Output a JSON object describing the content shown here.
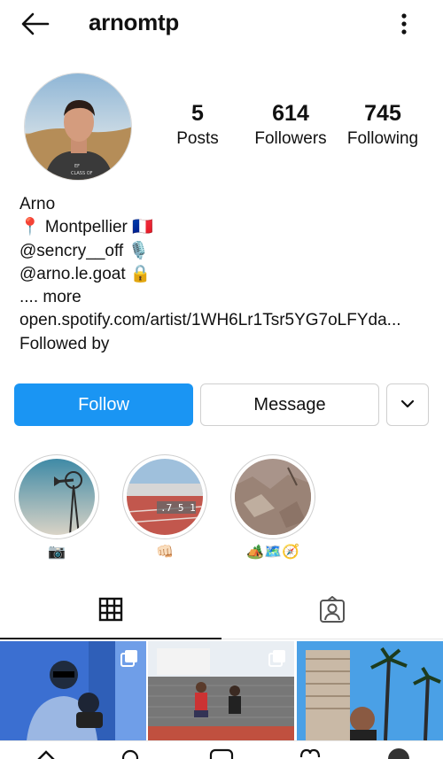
{
  "header": {
    "username": "arnomtp",
    "back_icon": "arrow-left-icon",
    "menu_icon": "kebab-icon"
  },
  "profile": {
    "avatar_icon": "profile-photo",
    "stats": {
      "posts_count": "5",
      "posts_label": "Posts",
      "followers_count": "614",
      "followers_label": "Followers",
      "following_count": "745",
      "following_label": "Following"
    },
    "bio": {
      "name": "Arno",
      "location": "📍 Montpellier 🇫🇷",
      "mention1": "@sencry__off 🎙️",
      "mention2": "@arno.le.goat 🔒",
      "more": ".... more",
      "link": "open.spotify.com/artist/1WH6Lr1Tsr5YG7oLFYda...",
      "followed_by": "Followed by"
    }
  },
  "actions": {
    "follow_label": "Follow",
    "message_label": "Message",
    "more_icon": "chevron-down-icon"
  },
  "highlights": [
    {
      "label": "📷"
    },
    {
      "label": "👊🏻"
    },
    {
      "label": "🏕️🗺️🧭"
    }
  ],
  "tabs": {
    "grid_icon": "grid-icon",
    "tagged_icon": "tagged-icon"
  },
  "colors": {
    "follow_blue": "#1a95f3",
    "text": "#111111",
    "border": "#cfcfcf"
  }
}
